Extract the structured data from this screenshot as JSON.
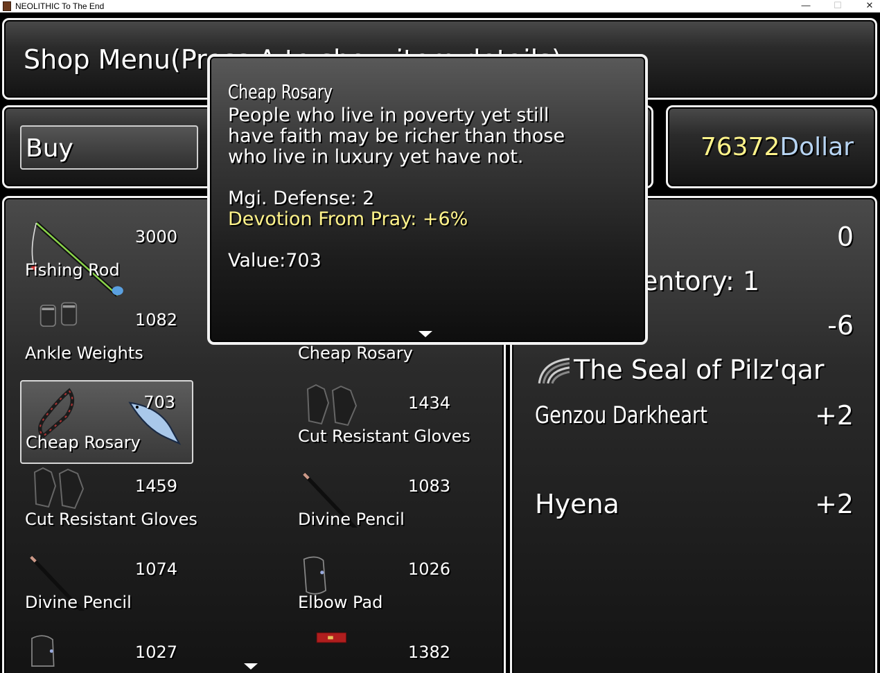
{
  "window": {
    "title": "NEOLITHIC To The End"
  },
  "header": {
    "text": "Shop Menu(Press A to show item details)"
  },
  "command": {
    "buy_label": "Buy"
  },
  "gold": {
    "amount": "76372",
    "unit": "Dollar"
  },
  "items": [
    {
      "name": "Fishing Rod",
      "price": "3000",
      "icon": "fishing-rod-icon"
    },
    {
      "name": "Ankle Weights",
      "price": "1082",
      "icon": "ankle-weights-icon"
    },
    {
      "name": "Cheap Rosary",
      "price": "",
      "icon": ""
    },
    {
      "name": "Cheap Rosary",
      "price": "703",
      "icon": "rosary-icon",
      "selected": true
    },
    {
      "name": "Cut Resistant Gloves",
      "price": "1434",
      "icon": "gloves-icon"
    },
    {
      "name": "Cut Resistant Gloves",
      "price": "1459",
      "icon": "gloves-icon"
    },
    {
      "name": "Divine Pencil",
      "price": "1083",
      "icon": "pencil-icon"
    },
    {
      "name": "Divine Pencil",
      "price": "1074",
      "icon": "pencil-icon"
    },
    {
      "name": "Elbow Pad",
      "price": "1026",
      "icon": "elbow-pad-icon"
    },
    {
      "name": "",
      "price": "1027",
      "icon": "pad-icon"
    },
    {
      "name": "",
      "price": "1382",
      "icon": "red-banner-icon"
    }
  ],
  "status": {
    "possession_value": "0",
    "inventory_label": "entory: 1",
    "change_value": "-6",
    "seal_title": "The Seal of Pilz'qar",
    "members": [
      {
        "name": "Genzou Darkheart",
        "value": "+2"
      },
      {
        "name": "Hyena",
        "value": "+2"
      }
    ]
  },
  "tooltip": {
    "title": "Cheap Rosary",
    "desc1": "People who live in poverty yet still",
    "desc2": "have faith may be richer than those",
    "desc3": "who live in luxury yet have not.",
    "stat1": "Mgi. Defense: 2",
    "stat2": "Devotion From Pray: +6%",
    "value": "Value:703"
  },
  "colors": {
    "gold_amount": "#fff38a",
    "gold_unit": "#b7d4f2",
    "highlight_text": "#fff38a"
  }
}
